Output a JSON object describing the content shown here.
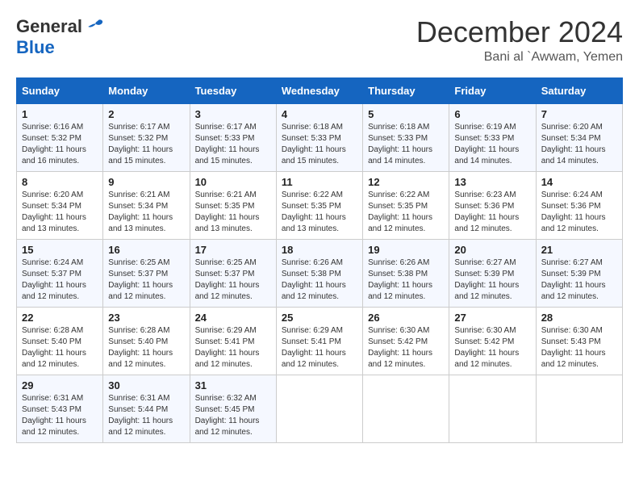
{
  "logo": {
    "general": "General",
    "blue": "Blue"
  },
  "title": "December 2024",
  "location": "Bani al `Awwam, Yemen",
  "days_of_week": [
    "Sunday",
    "Monday",
    "Tuesday",
    "Wednesday",
    "Thursday",
    "Friday",
    "Saturday"
  ],
  "weeks": [
    [
      {
        "day": 1,
        "sunrise": "6:16 AM",
        "sunset": "5:32 PM",
        "daylight": "11 hours and 16 minutes."
      },
      {
        "day": 2,
        "sunrise": "6:17 AM",
        "sunset": "5:32 PM",
        "daylight": "11 hours and 15 minutes."
      },
      {
        "day": 3,
        "sunrise": "6:17 AM",
        "sunset": "5:33 PM",
        "daylight": "11 hours and 15 minutes."
      },
      {
        "day": 4,
        "sunrise": "6:18 AM",
        "sunset": "5:33 PM",
        "daylight": "11 hours and 15 minutes."
      },
      {
        "day": 5,
        "sunrise": "6:18 AM",
        "sunset": "5:33 PM",
        "daylight": "11 hours and 14 minutes."
      },
      {
        "day": 6,
        "sunrise": "6:19 AM",
        "sunset": "5:33 PM",
        "daylight": "11 hours and 14 minutes."
      },
      {
        "day": 7,
        "sunrise": "6:20 AM",
        "sunset": "5:34 PM",
        "daylight": "11 hours and 14 minutes."
      }
    ],
    [
      {
        "day": 8,
        "sunrise": "6:20 AM",
        "sunset": "5:34 PM",
        "daylight": "11 hours and 13 minutes."
      },
      {
        "day": 9,
        "sunrise": "6:21 AM",
        "sunset": "5:34 PM",
        "daylight": "11 hours and 13 minutes."
      },
      {
        "day": 10,
        "sunrise": "6:21 AM",
        "sunset": "5:35 PM",
        "daylight": "11 hours and 13 minutes."
      },
      {
        "day": 11,
        "sunrise": "6:22 AM",
        "sunset": "5:35 PM",
        "daylight": "11 hours and 13 minutes."
      },
      {
        "day": 12,
        "sunrise": "6:22 AM",
        "sunset": "5:35 PM",
        "daylight": "11 hours and 12 minutes."
      },
      {
        "day": 13,
        "sunrise": "6:23 AM",
        "sunset": "5:36 PM",
        "daylight": "11 hours and 12 minutes."
      },
      {
        "day": 14,
        "sunrise": "6:24 AM",
        "sunset": "5:36 PM",
        "daylight": "11 hours and 12 minutes."
      }
    ],
    [
      {
        "day": 15,
        "sunrise": "6:24 AM",
        "sunset": "5:37 PM",
        "daylight": "11 hours and 12 minutes."
      },
      {
        "day": 16,
        "sunrise": "6:25 AM",
        "sunset": "5:37 PM",
        "daylight": "11 hours and 12 minutes."
      },
      {
        "day": 17,
        "sunrise": "6:25 AM",
        "sunset": "5:37 PM",
        "daylight": "11 hours and 12 minutes."
      },
      {
        "day": 18,
        "sunrise": "6:26 AM",
        "sunset": "5:38 PM",
        "daylight": "11 hours and 12 minutes."
      },
      {
        "day": 19,
        "sunrise": "6:26 AM",
        "sunset": "5:38 PM",
        "daylight": "11 hours and 12 minutes."
      },
      {
        "day": 20,
        "sunrise": "6:27 AM",
        "sunset": "5:39 PM",
        "daylight": "11 hours and 12 minutes."
      },
      {
        "day": 21,
        "sunrise": "6:27 AM",
        "sunset": "5:39 PM",
        "daylight": "11 hours and 12 minutes."
      }
    ],
    [
      {
        "day": 22,
        "sunrise": "6:28 AM",
        "sunset": "5:40 PM",
        "daylight": "11 hours and 12 minutes."
      },
      {
        "day": 23,
        "sunrise": "6:28 AM",
        "sunset": "5:40 PM",
        "daylight": "11 hours and 12 minutes."
      },
      {
        "day": 24,
        "sunrise": "6:29 AM",
        "sunset": "5:41 PM",
        "daylight": "11 hours and 12 minutes."
      },
      {
        "day": 25,
        "sunrise": "6:29 AM",
        "sunset": "5:41 PM",
        "daylight": "11 hours and 12 minutes."
      },
      {
        "day": 26,
        "sunrise": "6:30 AM",
        "sunset": "5:42 PM",
        "daylight": "11 hours and 12 minutes."
      },
      {
        "day": 27,
        "sunrise": "6:30 AM",
        "sunset": "5:42 PM",
        "daylight": "11 hours and 12 minutes."
      },
      {
        "day": 28,
        "sunrise": "6:30 AM",
        "sunset": "5:43 PM",
        "daylight": "11 hours and 12 minutes."
      }
    ],
    [
      {
        "day": 29,
        "sunrise": "6:31 AM",
        "sunset": "5:43 PM",
        "daylight": "11 hours and 12 minutes."
      },
      {
        "day": 30,
        "sunrise": "6:31 AM",
        "sunset": "5:44 PM",
        "daylight": "11 hours and 12 minutes."
      },
      {
        "day": 31,
        "sunrise": "6:32 AM",
        "sunset": "5:45 PM",
        "daylight": "11 hours and 12 minutes."
      },
      null,
      null,
      null,
      null
    ]
  ]
}
